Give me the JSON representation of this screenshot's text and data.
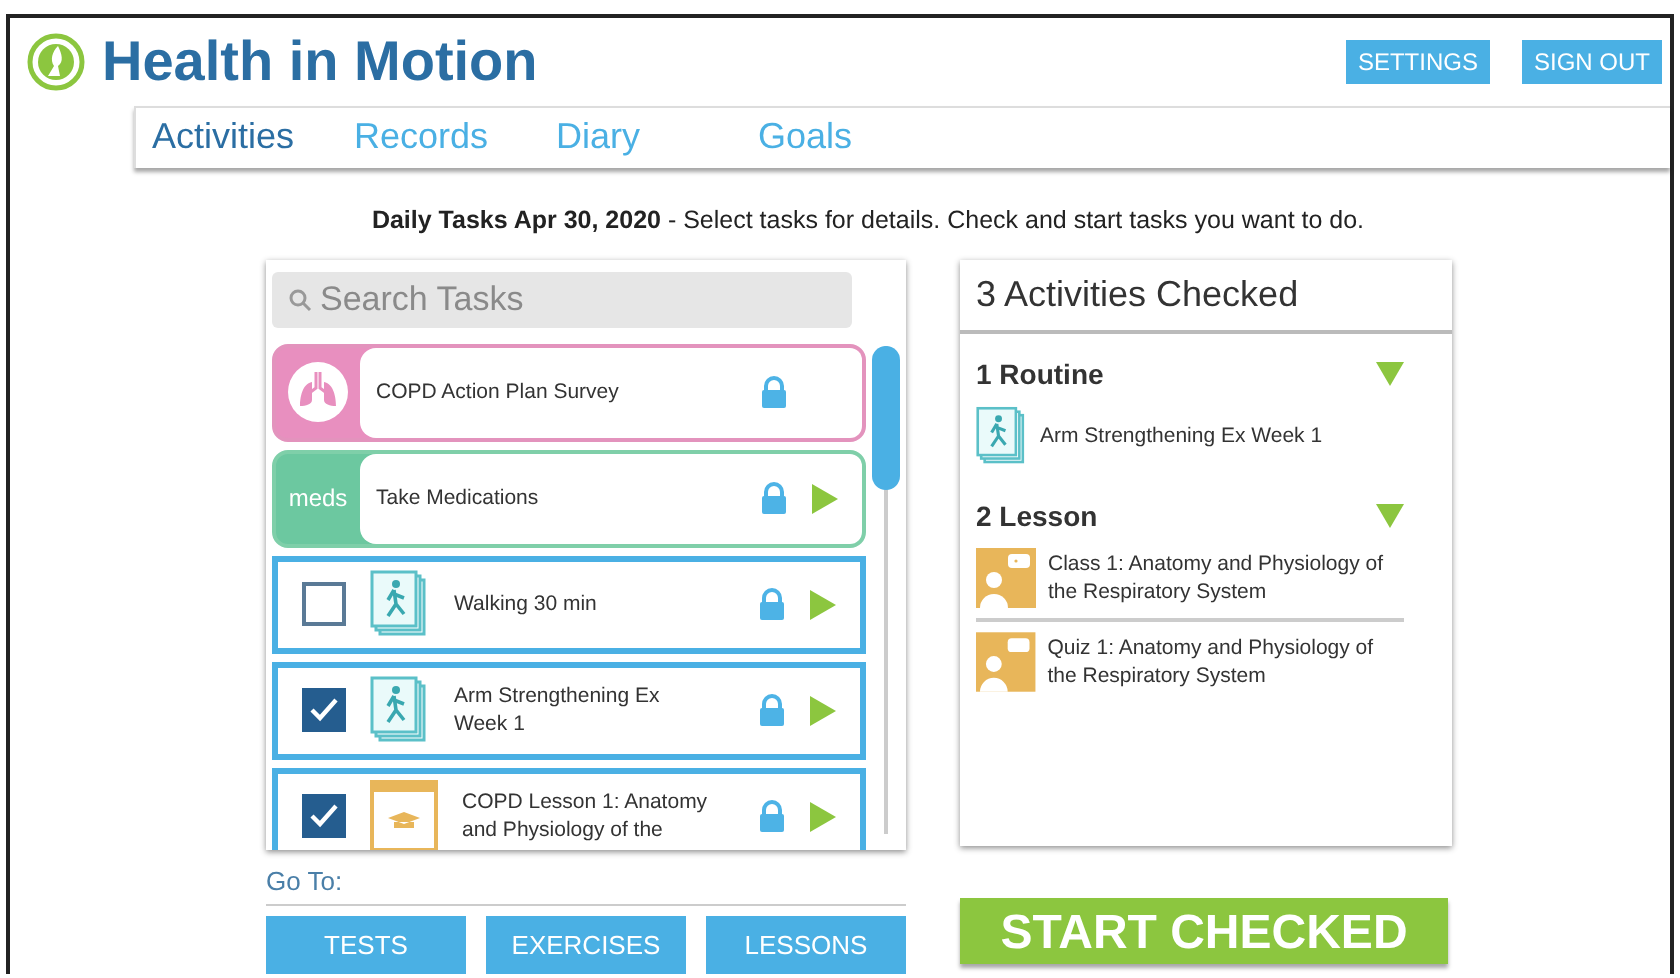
{
  "app": {
    "title": "Health in Motion"
  },
  "header_buttons": [
    "SETTINGS",
    "SIGN OUT"
  ],
  "tabs": [
    {
      "label": "Activities",
      "selected": true
    },
    {
      "label": "Records",
      "selected": false
    },
    {
      "label": "Diary",
      "selected": false
    },
    {
      "label": "Goals",
      "selected": false
    }
  ],
  "instructions": "**Daily Tasks Apr 30, 2020** - Select tasks for details. Check and start tasks you want to do.",
  "search": {
    "placeholder": "Search Tasks"
  },
  "tasks": [
    {
      "kind": "survey",
      "label": "COPD Action Plan Survey",
      "locked": true,
      "playable": false
    },
    {
      "kind": "meds",
      "badge": "meds",
      "label": "Take Medications",
      "locked": true,
      "playable": true
    },
    {
      "kind": "exercise",
      "label": "Walking 30 min",
      "checked": false,
      "locked": true,
      "playable": true
    },
    {
      "kind": "exercise",
      "label": "Arm Strengthening Ex Week 1",
      "checked": true,
      "locked": true,
      "playable": true
    },
    {
      "kind": "lesson",
      "label": "COPD Lesson 1: Anatomy and Physiology of the",
      "checked": true,
      "locked": true,
      "playable": true
    }
  ],
  "summary": {
    "title": "3 Activities Checked",
    "groups": [
      {
        "title": "1 Routine",
        "expanded": true,
        "items": [
          {
            "kind": "exercise",
            "label": "Arm Strengthening Ex Week 1"
          }
        ]
      },
      {
        "title": "2 Lesson",
        "expanded": true,
        "items": [
          {
            "kind": "class",
            "label": "Class 1: Anatomy and Physiology of the Respiratory System"
          },
          {
            "kind": "quiz",
            "label": "Quiz 1: Anatomy and Physiology of the Respiratory System"
          }
        ]
      }
    ]
  },
  "goto": {
    "label": "Go To:",
    "buttons": [
      "TESTS",
      "EXERCISES",
      "LESSONS"
    ]
  },
  "start_button": "START CHECKED"
}
